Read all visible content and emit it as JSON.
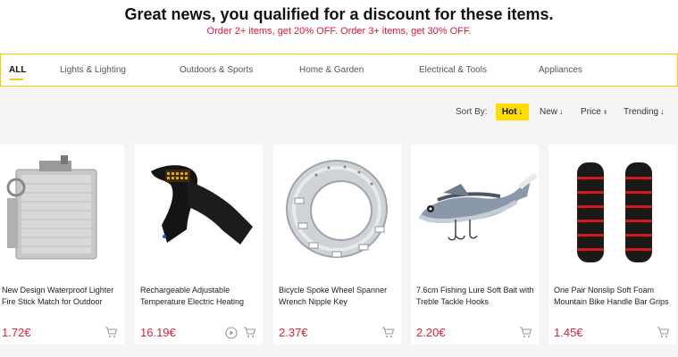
{
  "banner": {
    "headline": "Great news, you qualified for a discount for these items.",
    "subline": "Order 2+ items, get 20% OFF. Order 3+ items, get 30% OFF."
  },
  "categories": [
    {
      "label": "ALL"
    },
    {
      "label": "Lights & Lighting"
    },
    {
      "label": "Outdoors & Sports"
    },
    {
      "label": "Home & Garden"
    },
    {
      "label": "Electrical & Tools"
    },
    {
      "label": "Appliances"
    }
  ],
  "sort": {
    "label": "Sort By:",
    "options": [
      {
        "label": "Hot",
        "indicator": "arrow-down-icon"
      },
      {
        "label": "New",
        "indicator": "arrow-down-icon"
      },
      {
        "label": "Price",
        "indicator": "up-down-icon"
      },
      {
        "label": "Trending",
        "indicator": "arrow-down-icon"
      }
    ],
    "active": "Hot"
  },
  "products": [
    {
      "title": "New Design Waterproof Lighter Fire Stick Match for Outdoor",
      "price": "1.72€",
      "image": "lighter-image"
    },
    {
      "title": "Rechargeable Adjustable Temperature Electric Heating",
      "price": "16.19€",
      "image": "heated-scarf-image"
    },
    {
      "title": "Bicycle Spoke Wheel Spanner Wrench Nipple Key",
      "price": "2.37€",
      "image": "spoke-wrench-image"
    },
    {
      "title": "7.6cm Fishing Lure Soft Bait with Treble Tackle Hooks",
      "price": "2.20€",
      "image": "fishing-lure-image"
    },
    {
      "title": "One Pair Nonslip Soft Foam Mountain Bike Handle Bar Grips",
      "price": "1.45€",
      "image": "bike-grips-image"
    }
  ],
  "colors": {
    "accent": "#ffdd00",
    "price": "#d8233b",
    "discount_text": "#e2173b"
  }
}
